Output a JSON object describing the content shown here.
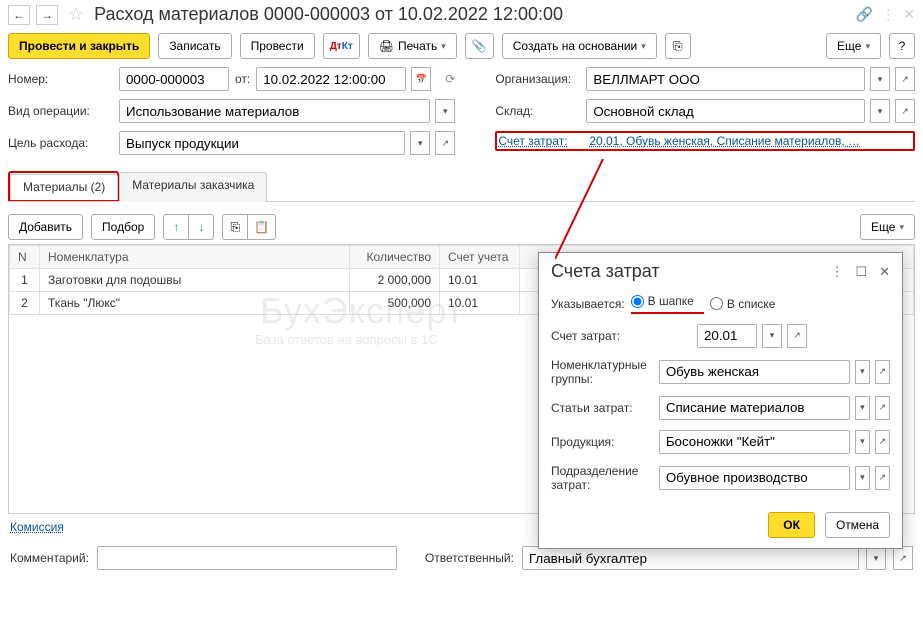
{
  "title": "Расход материалов 0000-000003 от 10.02.2022 12:00:00",
  "toolbar": {
    "post_close": "Провести и закрыть",
    "save": "Записать",
    "post": "Провести",
    "print": "Печать",
    "create_based": "Создать на основании",
    "more": "Еще",
    "help": "?"
  },
  "form": {
    "number_label": "Номер:",
    "number": "0000-000003",
    "date_label": "от:",
    "date": "10.02.2022 12:00:00",
    "op_type_label": "Вид операции:",
    "op_type": "Использование материалов",
    "purpose_label": "Цель расхода:",
    "purpose": "Выпуск продукции",
    "org_label": "Организация:",
    "org": "ВЕЛЛМАРТ ООО",
    "warehouse_label": "Склад:",
    "warehouse": "Основной склад",
    "cost_acc_label": "Счет затрат:",
    "cost_acc_link": "20.01, Обувь женская, Списание материалов, …"
  },
  "tabs": {
    "materials": "Материалы (2)",
    "customer_materials": "Материалы заказчика"
  },
  "table_toolbar": {
    "add": "Добавить",
    "pick": "Подбор",
    "more": "Еще"
  },
  "table": {
    "headers": {
      "n": "N",
      "item": "Номенклатура",
      "qty": "Количество",
      "acc": "Счет учета"
    },
    "rows": [
      {
        "n": "1",
        "item": "Заготовки для подошвы",
        "qty": "2 000,000",
        "acc": "10.01"
      },
      {
        "n": "2",
        "item": "Ткань \"Люкс\"",
        "qty": "500,000",
        "acc": "10.01"
      }
    ]
  },
  "popup": {
    "title": "Счета затрат",
    "specify_label": "Указывается:",
    "radio_header": "В шапке",
    "radio_list": "В списке",
    "account_label": "Счет затрат:",
    "account": "20.01",
    "nomgroup_label": "Номенклатурные группы:",
    "nomgroup": "Обувь женская",
    "cost_item_label": "Статьи затрат:",
    "cost_item": "Списание материалов",
    "product_label": "Продукция:",
    "product": "Босоножки \"Кейт\"",
    "division_label": "Подразделение затрат:",
    "division": "Обувное производство",
    "ok": "ОК",
    "cancel": "Отмена"
  },
  "bottom": {
    "commission": "Комиссия",
    "comment_label": "Комментарий:",
    "responsible_label": "Ответственный:",
    "responsible": "Главный бухгалтер"
  }
}
